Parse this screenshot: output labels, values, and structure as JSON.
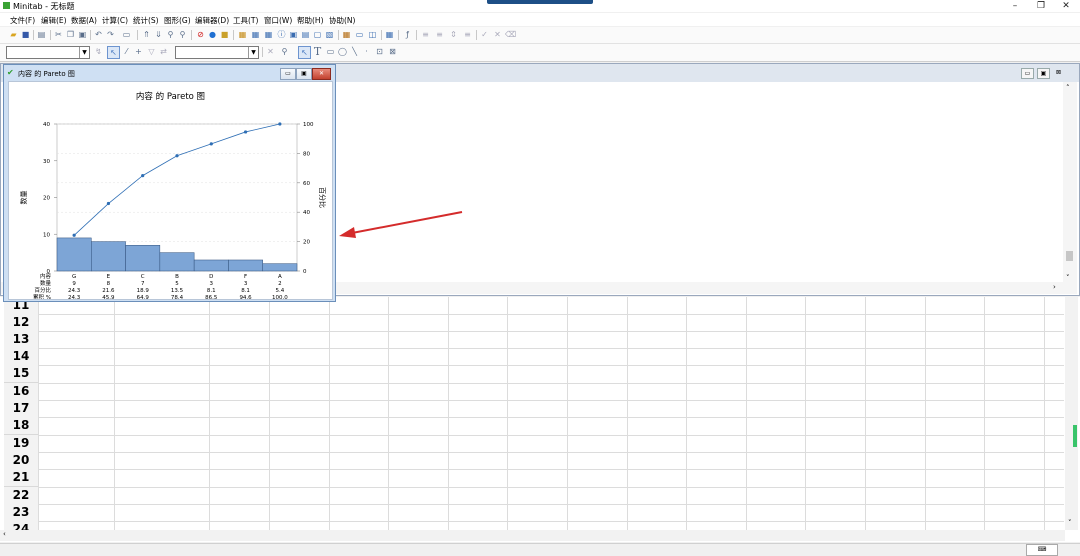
{
  "app": {
    "title": "Minitab - 无标题"
  },
  "window_controls": {
    "minimize": "–",
    "restore": "❐",
    "close": "✕"
  },
  "menu": [
    "文件(F)",
    "编辑(E)",
    "数据(A)",
    "计算(C)",
    "统计(S)",
    "图形(G)",
    "编辑器(D)",
    "工具(T)",
    "窗口(W)",
    "帮助(H)",
    "协助(N)"
  ],
  "graph_window": {
    "title": "内容 的 Pareto 图",
    "controls": {
      "minimize": "▭",
      "maximize": "▣",
      "close": "✕"
    }
  },
  "chart_data": {
    "type": "bar",
    "title": "内容 的 Pareto 图",
    "ylabel": "数量",
    "y2label": "百分比",
    "ylim": [
      0,
      40
    ],
    "y2lim": [
      0,
      100
    ],
    "yticks": [
      0,
      10,
      20,
      30,
      40
    ],
    "y2ticks": [
      0,
      20,
      40,
      60,
      80,
      100
    ],
    "categories": [
      "G",
      "E",
      "C",
      "B",
      "D",
      "F",
      "A"
    ],
    "values": [
      9,
      8,
      7,
      5,
      3,
      3,
      2
    ],
    "percent": [
      "24.3",
      "21.6",
      "18.9",
      "13.5",
      "8.1",
      "8.1",
      "5.4"
    ],
    "cumulative": [
      "24.3",
      "45.9",
      "64.9",
      "78.4",
      "86.5",
      "94.6",
      "100.0"
    ],
    "table_labels": [
      "内容",
      "数量",
      "百分比",
      "累积 %"
    ],
    "bar_color": "#7da5d6",
    "line_color": "#2f6fb5"
  },
  "worksheet": {
    "rows": [
      "11",
      "12",
      "13",
      "14",
      "15",
      "16",
      "17",
      "18",
      "19",
      "20",
      "21",
      "22",
      "23",
      "24"
    ]
  },
  "colors": {
    "arrow": "#d42b2b",
    "graph_frame": "#cfe0f3"
  }
}
